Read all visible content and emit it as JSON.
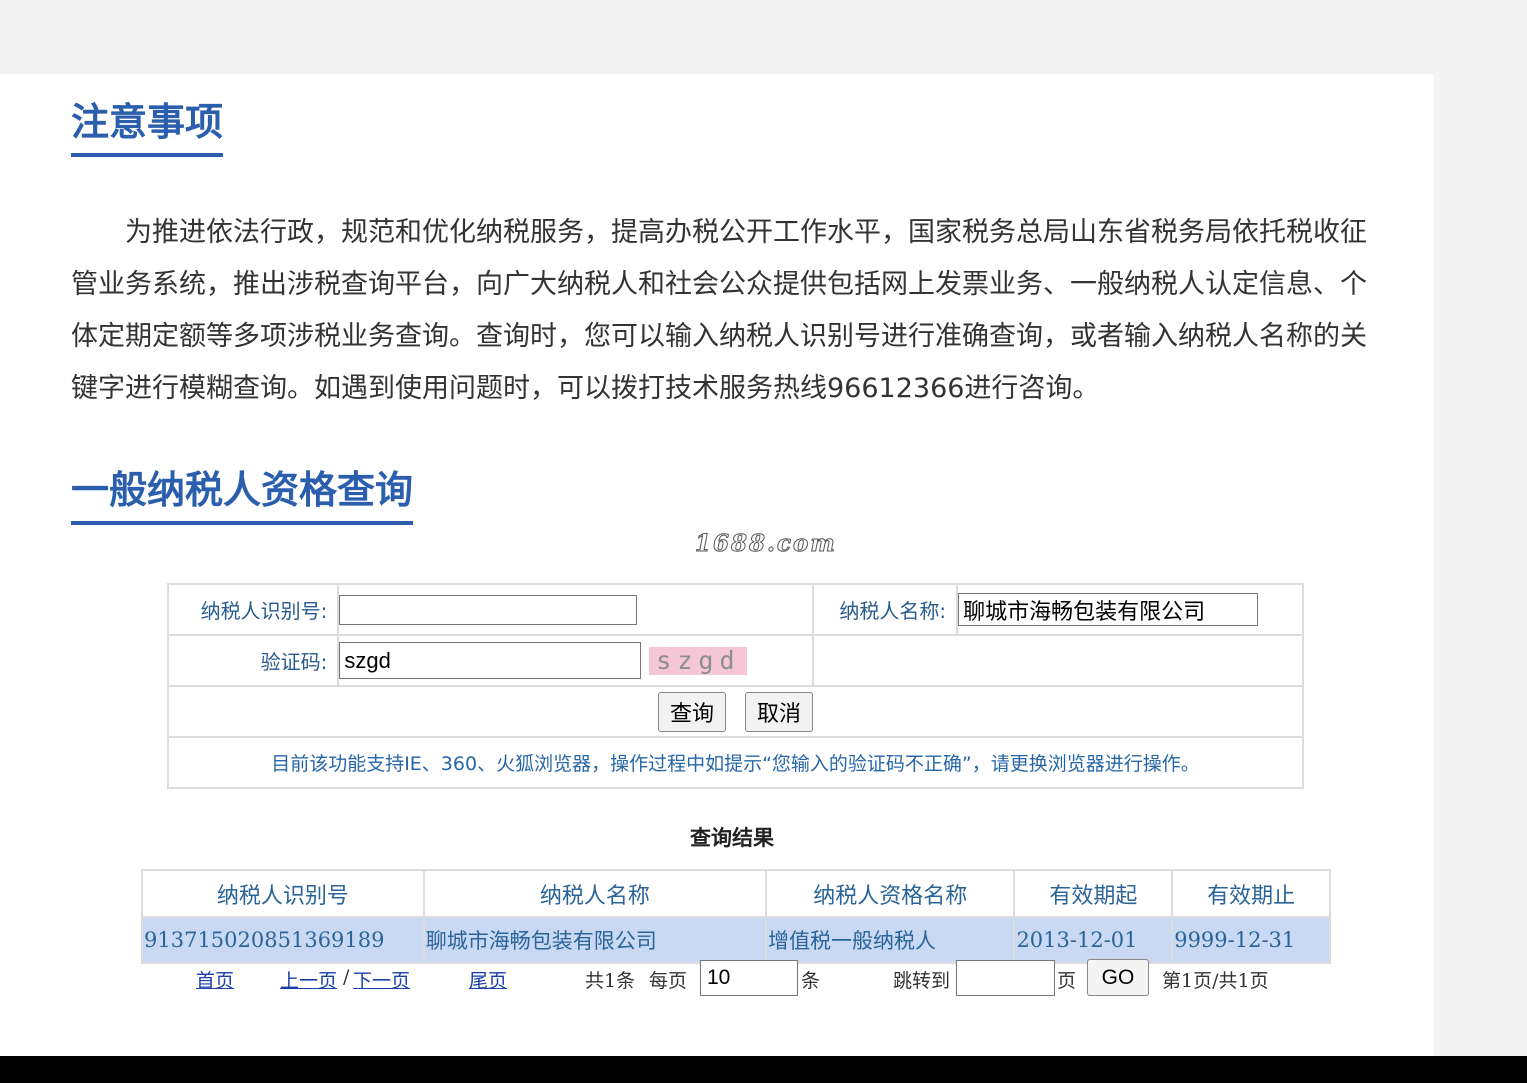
{
  "notice": {
    "title": "注意事项",
    "body": "为推进依法行政，规范和优化纳税服务，提高办税公开工作水平，国家税务总局山东省税务局依托税收征管业务系统，推出涉税查询平台，向广大纳税人和社会公众提供包括网上发票业务、一般纳税人认定信息、个体定期定额等多项涉税业务查询。查询时，您可以输入纳税人识别号进行准确查询，或者输入纳税人名称的关键字进行模糊查询。如遇到使用问题时，可以拨打技术服务热线96612366进行咨询。"
  },
  "query": {
    "title": "一般纳税人资格查询",
    "watermark": "1688.com",
    "taxpayer_id_label": "纳税人识别号:",
    "taxpayer_id_value": "",
    "taxpayer_name_label": "纳税人名称:",
    "taxpayer_name_value": "聊城市海畅包装有限公司",
    "captcha_label": "验证码:",
    "captcha_value": "szgd",
    "captcha_image_text": "szgd",
    "search_button": "查询",
    "cancel_button": "取消",
    "browser_note": "目前该功能支持IE、360、火狐浏览器，操作过程中如提示“您输入的验证码不正确”，请更换浏览器进行操作。"
  },
  "results": {
    "title": "查询结果",
    "headers": [
      "纳税人识别号",
      "纳税人名称",
      "纳税人资格名称",
      "有效期起",
      "有效期止"
    ],
    "rows": [
      [
        "913715020851369189",
        "聊城市海畅包装有限公司",
        "增值税一般纳税人",
        "2013-12-01",
        "9999-12-31"
      ]
    ]
  },
  "pager": {
    "first": "首页",
    "prev": "上一页",
    "separator": "/",
    "next": "下一页",
    "last": "尾页",
    "total": "共1条",
    "per_page_label": "每页",
    "per_page_value": "10",
    "per_page_unit": "条",
    "jump_label": "跳转到",
    "jump_value": "",
    "jump_unit": "页",
    "go_button": "GO",
    "page_status": "第1页/共1页"
  },
  "colors": {
    "accent": "#2b5fad",
    "link": "#1a3fa8",
    "row_highlight": "#c9d9f3",
    "captcha_bg": "#f5c7d6"
  }
}
